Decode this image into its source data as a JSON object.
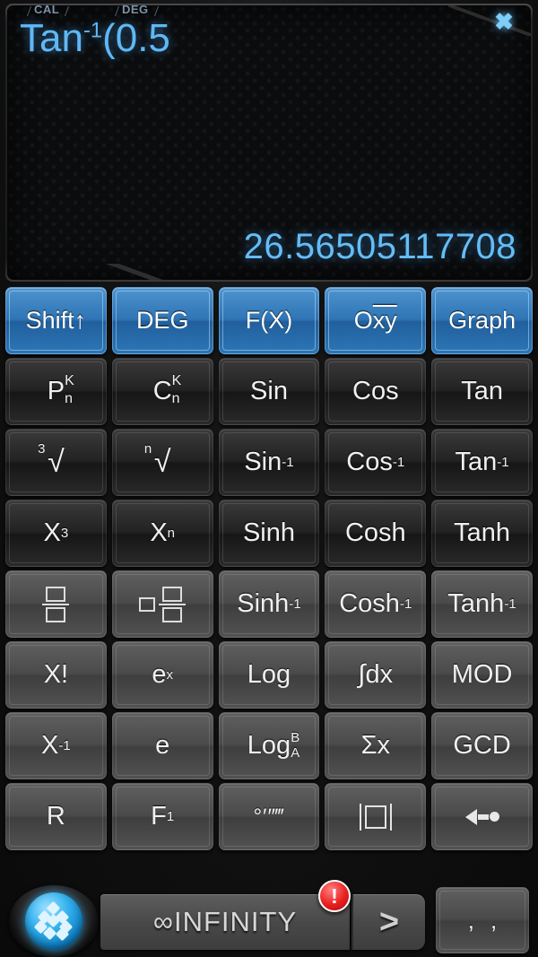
{
  "display": {
    "tabs": [
      {
        "id": "cal",
        "label": "CAL"
      },
      {
        "id": "deg",
        "label": "DEG"
      }
    ],
    "expression_base": "Tan",
    "expression_sup": "-1",
    "expression_rest": "(0.5",
    "result": "26.56505117708",
    "close_icon": "close-icon"
  },
  "keypad": {
    "rows": [
      {
        "style": "blue",
        "keys": [
          {
            "name": "shift-key",
            "label": "Shift",
            "suffix": "↑"
          },
          {
            "name": "deg-mode-key",
            "label": "DEG"
          },
          {
            "name": "fx-key",
            "label": "F(X)"
          },
          {
            "name": "oxy-key",
            "label": "O",
            "overline": "xy"
          },
          {
            "name": "graph-key",
            "label": "Graph"
          }
        ]
      },
      {
        "style": "dark",
        "keys": [
          {
            "name": "permutation-key",
            "label": "P",
            "sup": "K",
            "sub": "n"
          },
          {
            "name": "combination-key",
            "label": "C",
            "sup": "K",
            "sub": "n"
          },
          {
            "name": "sin-key",
            "label": "Sin"
          },
          {
            "name": "cos-key",
            "label": "Cos"
          },
          {
            "name": "tan-key",
            "label": "Tan"
          }
        ]
      },
      {
        "style": "dark",
        "keys": [
          {
            "name": "cube-root-key",
            "label": "√",
            "index": "3"
          },
          {
            "name": "nth-root-key",
            "label": "√",
            "index": "n"
          },
          {
            "name": "arcsin-key",
            "label": "Sin",
            "sup": "-1"
          },
          {
            "name": "arccos-key",
            "label": "Cos",
            "sup": "-1"
          },
          {
            "name": "arctan-key",
            "label": "Tan",
            "sup": "-1"
          }
        ]
      },
      {
        "style": "dark",
        "keys": [
          {
            "name": "x-cubed-key",
            "label": "X",
            "sup": "3"
          },
          {
            "name": "x-power-n-key",
            "label": "X",
            "sup": "n"
          },
          {
            "name": "sinh-key",
            "label": "Sinh"
          },
          {
            "name": "cosh-key",
            "label": "Cosh"
          },
          {
            "name": "tanh-key",
            "label": "Tanh"
          }
        ]
      },
      {
        "style": "light",
        "keys": [
          {
            "name": "fraction-key",
            "icon": "fraction-icon"
          },
          {
            "name": "mixed-fraction-key",
            "icon": "mixed-fraction-icon"
          },
          {
            "name": "arcsinh-key",
            "label": "Sinh",
            "sup": "-1"
          },
          {
            "name": "arccosh-key",
            "label": "Cosh",
            "sup": "-1"
          },
          {
            "name": "arctanh-key",
            "label": "Tanh",
            "sup": "-1"
          }
        ]
      },
      {
        "style": "light",
        "keys": [
          {
            "name": "factorial-key",
            "label": "X!"
          },
          {
            "name": "exp-key",
            "label": "e",
            "sup": "x"
          },
          {
            "name": "log-key",
            "label": "Log"
          },
          {
            "name": "integral-key",
            "label": "∫dx"
          },
          {
            "name": "mod-key",
            "label": "MOD"
          }
        ]
      },
      {
        "style": "light",
        "keys": [
          {
            "name": "reciprocal-key",
            "label": "X",
            "sup": "-1"
          },
          {
            "name": "euler-key",
            "label": "e"
          },
          {
            "name": "log-base-key",
            "label": "Log",
            "sup": "B",
            "sub": "A"
          },
          {
            "name": "sum-key",
            "label": "Σx"
          },
          {
            "name": "gcd-key",
            "label": "GCD"
          }
        ]
      },
      {
        "style": "light",
        "keys": [
          {
            "name": "r-key",
            "label": "R"
          },
          {
            "name": "f1-key",
            "label": "F",
            "sub": "1"
          },
          {
            "name": "dms-key",
            "icon": "degrees-minutes-seconds-icon",
            "label": "°′″‴"
          },
          {
            "name": "absolute-value-key",
            "icon": "absolute-value-icon"
          },
          {
            "name": "backspace-key",
            "icon": "backspace-icon"
          }
        ]
      }
    ]
  },
  "bottom_bar": {
    "home_icon": "home-diamond-icon",
    "brand": "∞INFINITY",
    "next_icon": "chevron-right-icon",
    "next_label": ">",
    "badge": "!",
    "separator_key": {
      "name": "separator-key",
      "top_left": "·",
      "top_right": "·",
      "bottom_left": ",",
      "bottom_right": ","
    }
  },
  "colors": {
    "accent_blue": "#5fb8f5",
    "key_blue": "#2f74b4",
    "badge_red": "#e8201f",
    "display_bg": "#0b0c0d"
  }
}
